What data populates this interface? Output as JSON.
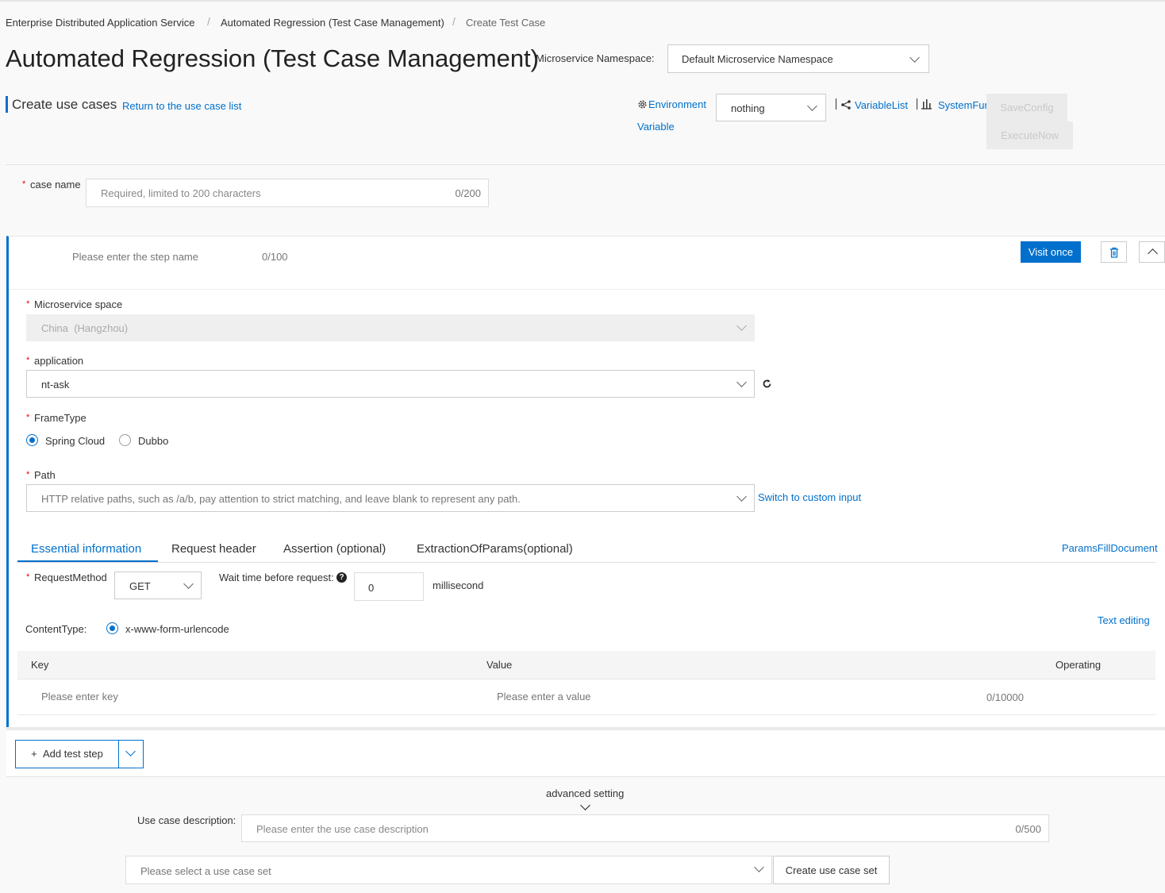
{
  "breadcrumb": {
    "items": [
      "Enterprise Distributed Application Service",
      "Automated Regression (Test Case Management)",
      "Create Test Case"
    ],
    "separator": "/"
  },
  "header": {
    "title": "Automated Regression (Test Case Management)",
    "namespace_label": "Microservice Namespace:",
    "namespace_value": "Default Microservice Namespace"
  },
  "section": {
    "title": "Create use cases",
    "return_link": "Return to the use case list"
  },
  "toolbar": {
    "environment_link": "Environment",
    "variable_link": "Variable",
    "environment_value": "nothing",
    "variable_list": "VariableList",
    "system_fun": "SystemFun",
    "save_config": "SaveConfig",
    "execute_now": "ExecuteNow"
  },
  "case_name": {
    "label": "case name",
    "placeholder": "Required, limited to 200 characters",
    "counter": "0/200"
  },
  "step": {
    "name_placeholder": "Please enter the step name",
    "name_counter": "0/100",
    "visit_once": "Visit once",
    "microservice_space_label": "Microservice space",
    "microservice_space_value": "China  (Hangzhou)",
    "application_label": "application",
    "application_value": "nt-ask",
    "frame_type_label": "FrameType",
    "frame_types": [
      "Spring Cloud",
      "Dubbo"
    ],
    "frame_type_selected": "Spring Cloud",
    "path_label": "Path",
    "path_placeholder": "HTTP relative paths, such as /a/b, pay attention to strict matching, and leave blank to represent any path.",
    "switch_custom": "Switch to custom input"
  },
  "tabs": {
    "items": [
      "Essential information",
      "Request header",
      "Assertion (optional)",
      "ExtractionOfParams(optional)"
    ],
    "active": "Essential information",
    "params_doc": "ParamsFillDocument"
  },
  "request": {
    "method_label": "RequestMethod",
    "method_value": "GET",
    "wait_label": "Wait time before request:",
    "wait_value": "0",
    "wait_unit": "millisecond",
    "content_type_label": "ContentType:",
    "content_type_value": "x-www-form-urlencode",
    "text_editing": "Text editing"
  },
  "params_table": {
    "columns": [
      "Key",
      "Value",
      "Operating"
    ],
    "key_placeholder": "Please enter key",
    "value_placeholder": "Please enter a value",
    "value_counter": "0/10000"
  },
  "add_step": {
    "label": "Add test step",
    "plus": "+"
  },
  "advanced": {
    "label": "advanced setting",
    "description_label": "Use case description:",
    "description_placeholder": "Please enter the use case description",
    "description_counter": "0/500",
    "case_set_placeholder": "Please select a use case set",
    "create_case_set": "Create use case set"
  },
  "colors": {
    "accent": "#0070cc",
    "required": "#e00000",
    "disabled_bg": "#ebebeb"
  }
}
